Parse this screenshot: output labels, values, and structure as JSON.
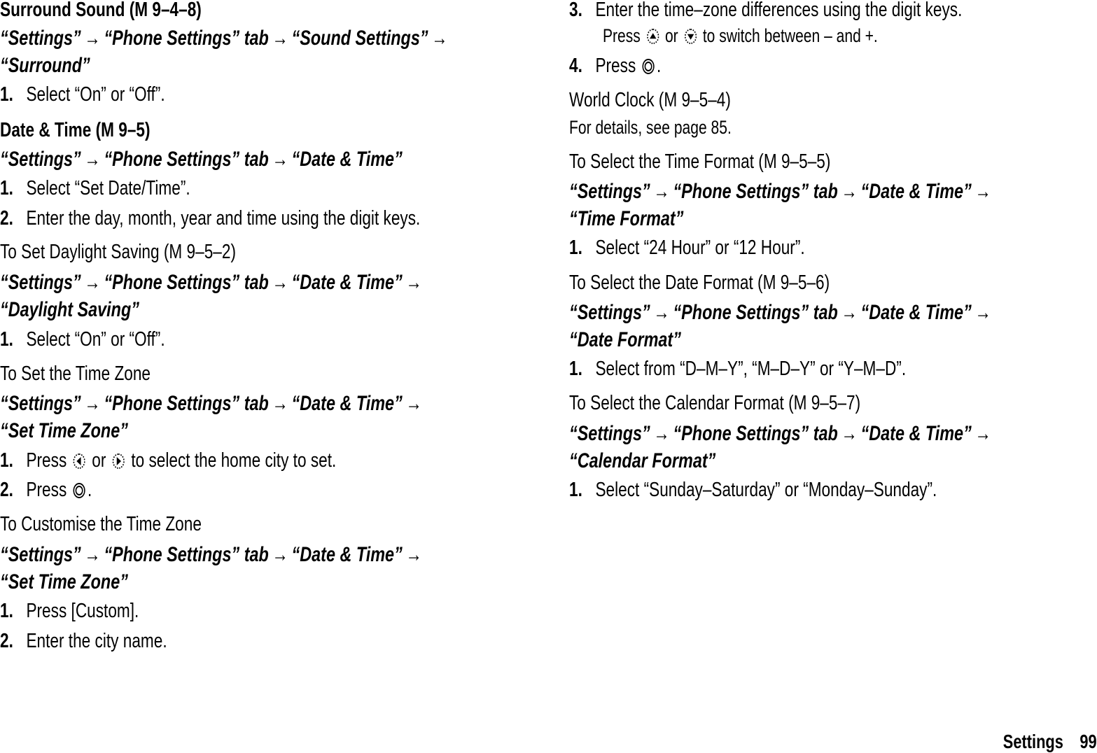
{
  "left": {
    "surround": {
      "title": "Surround Sound",
      "ref": "(M 9–4–8)",
      "path": [
        "“Settings”",
        "“Phone Settings” tab",
        "“Sound Settings”",
        "“Surround”"
      ],
      "steps": [
        {
          "num": "1.",
          "text": "Select “On” or “Off”."
        }
      ]
    },
    "date_time": {
      "title": "Date & Time",
      "ref": "(M 9–5)",
      "path": [
        "“Settings”",
        "“Phone Settings” tab",
        "“Date & Time”"
      ],
      "steps": [
        {
          "num": "1.",
          "text": "Select “Set Date/Time”."
        },
        {
          "num": "2.",
          "text": "Enter the day, month, year and time using the digit keys."
        }
      ]
    },
    "daylight": {
      "title": "To Set Daylight Saving",
      "ref": "(M 9–5–2)",
      "path": [
        "“Settings”",
        "“Phone Settings” tab",
        "“Date & Time”",
        "“Daylight Saving”"
      ],
      "steps": [
        {
          "num": "1.",
          "text": "Select “On” or “Off”."
        }
      ]
    },
    "time_zone": {
      "title": "To Set the Time Zone",
      "path": [
        "“Settings”",
        "“Phone Settings” tab",
        "“Date & Time”",
        "“Set Time Zone”"
      ],
      "steps": [
        {
          "num": "1.",
          "pre": "Press",
          "mid": "or",
          "post": "to select the home city to set."
        },
        {
          "num": "2.",
          "pre": "Press",
          "post": "."
        }
      ]
    },
    "customise": {
      "title": "To Customise the Time Zone",
      "path": [
        "“Settings”",
        "“Phone Settings” tab",
        "“Date & Time”",
        "“Set Time Zone”"
      ],
      "steps": [
        {
          "num": "1.",
          "text": "Press [Custom]."
        },
        {
          "num": "2.",
          "text": "Enter the city name."
        }
      ]
    }
  },
  "right": {
    "customise_cont": {
      "steps": [
        {
          "num": "3.",
          "text": "Enter the time–zone differences using the digit keys."
        },
        {
          "num": "4.",
          "pre": "Press",
          "post": "."
        }
      ],
      "sub_note": {
        "pre": "Press",
        "mid": "or",
        "post": "to switch between – and +."
      }
    },
    "world_clock": {
      "title": "World Clock",
      "ref": "(M 9–5–4)",
      "note": "For details, see page 85."
    },
    "time_format": {
      "title": "To Select the Time Format",
      "ref": "(M 9–5–5)",
      "path": [
        "“Settings”",
        "“Phone Settings” tab",
        "“Date & Time”",
        "“Time Format”"
      ],
      "steps": [
        {
          "num": "1.",
          "text": "Select “24 Hour” or “12 Hour”."
        }
      ]
    },
    "date_format": {
      "title": "To Select the Date Format",
      "ref": "(M 9–5–6)",
      "path": [
        "“Settings”",
        "“Phone Settings” tab",
        "“Date & Time”",
        "“Date Format”"
      ],
      "steps": [
        {
          "num": "1.",
          "text": "Select from “D–M–Y”, “M–D–Y” or “Y–M–D”."
        }
      ]
    },
    "calendar_format": {
      "title": "To Select the Calendar Format",
      "ref": "(M 9–5–7)",
      "path": [
        "“Settings”",
        "“Phone Settings” tab",
        "“Date & Time”",
        "“Calendar Format”"
      ],
      "steps": [
        {
          "num": "1.",
          "text": "Select “Sunday–Saturday” or “Monday–Sunday”."
        }
      ]
    }
  },
  "arrow": "→",
  "footer": {
    "section": "Settings",
    "page": "99"
  }
}
